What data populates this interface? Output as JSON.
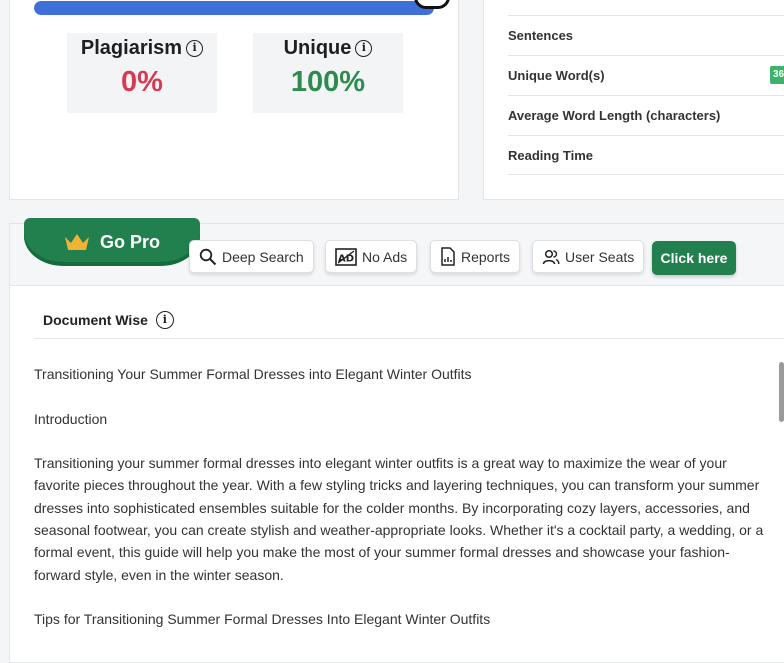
{
  "score": {
    "progress_percent": 100,
    "plagiarism_label": "Plagiarism",
    "plagiarism_value": "0%",
    "unique_label": "Unique",
    "unique_value": "100%"
  },
  "stats": {
    "rows": [
      "Sentences",
      "Unique Word(s)",
      "Average Word Length (characters)",
      "Reading Time"
    ],
    "unique_words_badge": "36"
  },
  "pro": {
    "go_pro_label": "Go Pro",
    "features": [
      "Deep Search",
      "No Ads",
      "Reports",
      "User Seats"
    ],
    "cta_label": "Click here"
  },
  "document": {
    "heading": "Document Wise",
    "paragraphs": [
      "Transitioning Your Summer Formal Dresses into Elegant Winter Outfits",
      "Introduction",
      "Transitioning your summer formal dresses into elegant winter outfits is a great way to maximize the wear of your favorite pieces throughout the year. With a few styling tricks and layering techniques, you can transform your summer dresses into sophisticated ensembles suitable for the colder months. By incorporating cozy layers, accessories, and seasonal footwear, you can create stylish and weather-appropriate looks. Whether it's a cocktail party, a wedding, or a formal event, this guide will help you make the most of your summer formal dresses and showcase your fashion-forward style, even in the winter season.",
      "Tips for Transitioning Summer Formal Dresses Into Elegant Winter Outfits"
    ]
  },
  "colors": {
    "accent_green": "#22804e",
    "plagiarism_red": "#d83a52",
    "unique_green": "#2e8b4e",
    "progress_blue": "#3f6fd8"
  },
  "icons": {
    "info": "info-icon",
    "crown": "crown-icon",
    "deep_search": "magnifier-icon",
    "no_ads": "ad-block-icon",
    "reports": "report-file-icon",
    "user_seats": "users-icon"
  }
}
